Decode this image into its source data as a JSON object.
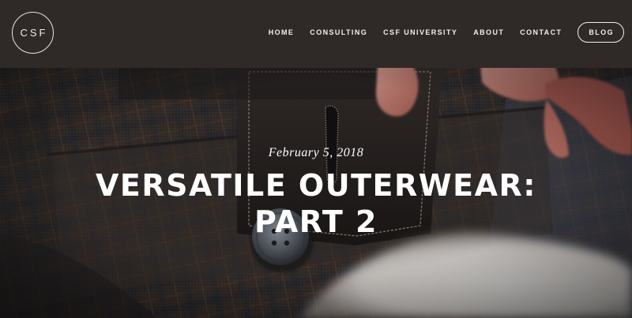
{
  "header": {
    "logo_text": "CSF",
    "nav": {
      "home": "HOME",
      "consulting": "CONSULTING",
      "university": "CSF UNIVERSITY",
      "about": "ABOUT",
      "contact": "CONTACT",
      "blog": "BLOG"
    }
  },
  "hero": {
    "date": "February 5, 2018",
    "title": "VERSATILE OUTERWEAR: PART 2"
  },
  "colors": {
    "header_bg": "#2f2a28",
    "text": "#ffffff",
    "fabric": "#3a332f"
  }
}
